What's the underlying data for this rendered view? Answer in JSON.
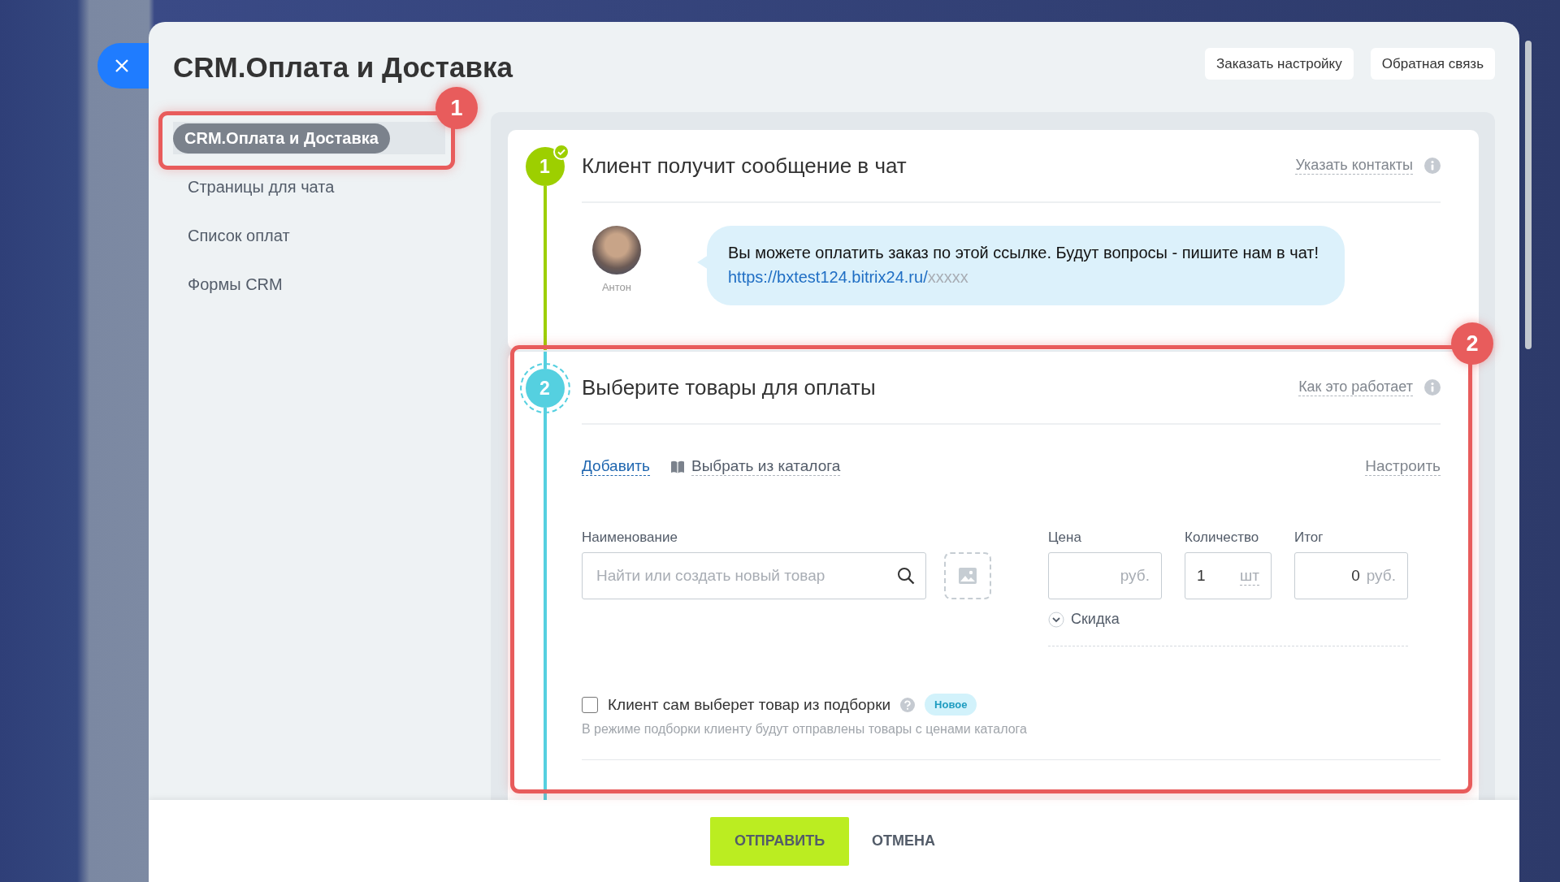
{
  "window": {
    "title": "CRM.Оплата и Доставка"
  },
  "header_buttons": [
    {
      "label": "Заказать настройку"
    },
    {
      "label": "Обратная связь"
    }
  ],
  "sidebar": {
    "items": [
      {
        "label": "CRM.Оплата и Доставка",
        "selected": true
      },
      {
        "label": "Страницы для чата",
        "selected": false
      },
      {
        "label": "Список оплат",
        "selected": false
      },
      {
        "label": "Формы CRM",
        "selected": false
      }
    ]
  },
  "steps": [
    {
      "number": "1",
      "completed": true,
      "active": false,
      "title": "Клиент получит сообщение в чат",
      "help_link": "Указать контакты"
    },
    {
      "number": "2",
      "completed": false,
      "active": true,
      "title": "Выберите товары для оплаты",
      "help_link": "Как это работает"
    }
  ],
  "chat": {
    "author": "Антон",
    "message": "Вы можете оплатить заказ по этой ссылке. Будут вопросы - пишите нам в чат!",
    "link": "https://bxtest124.bitrix24.ru/",
    "link_suffix": "xxxxx"
  },
  "products": {
    "actions": [
      {
        "label": "Добавить",
        "kind": "add"
      },
      {
        "label": "Выбрать из каталога",
        "kind": "catalog"
      }
    ],
    "settings_link": "Настроить",
    "name_field": {
      "label": "Наименование",
      "placeholder": "Найти или создать новый товар"
    },
    "price_field": {
      "label": "Цена",
      "unit": "руб."
    },
    "quantity_field": {
      "label": "Количество",
      "value": "1",
      "unit": "шт"
    },
    "total_field": {
      "label": "Итог",
      "value": "0",
      "unit": "руб."
    },
    "discount": {
      "label": "Скидка",
      "expanded": false
    },
    "selection": {
      "label": "Клиент сам выберет товар из подборки",
      "checked": false,
      "badge": "Новое",
      "hint": "В режиме подборки клиенту будут отправлены товары с ценами каталога"
    }
  },
  "footer": {
    "buttons": [
      {
        "label": "ОТПРАВИТЬ",
        "kind": "primary"
      },
      {
        "label": "ОТМЕНА",
        "kind": "link"
      }
    ]
  },
  "annotations": [
    {
      "number": "1"
    },
    {
      "number": "2"
    }
  ]
}
